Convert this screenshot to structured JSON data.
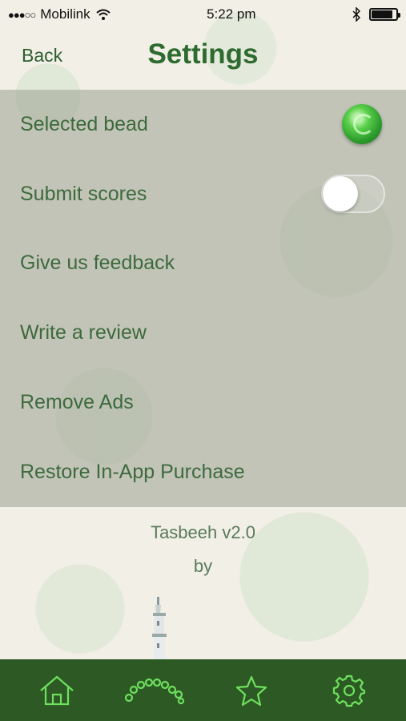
{
  "status_bar": {
    "signal": "●●●○○",
    "carrier": "Mobilink",
    "time": "5:22 pm",
    "bluetooth_icon": "bluetooth-icon",
    "battery_icon": "battery-icon"
  },
  "nav": {
    "back_label": "Back",
    "title": "Settings"
  },
  "settings": [
    {
      "label": "Selected bead",
      "control": "bead"
    },
    {
      "label": "Submit scores",
      "control": "toggle",
      "value": false
    },
    {
      "label": "Give us feedback"
    },
    {
      "label": "Write a review"
    },
    {
      "label": "Remove Ads"
    },
    {
      "label": "Restore In-App Purchase"
    }
  ],
  "footer": {
    "app_version": "Tasbeeh v2.0",
    "by": "by"
  },
  "tab_bar": {
    "tabs": [
      {
        "icon": "home-icon"
      },
      {
        "icon": "beads-icon"
      },
      {
        "icon": "star-icon"
      },
      {
        "icon": "gear-icon"
      }
    ]
  },
  "colors": {
    "accent": "#2e6b2e",
    "tab_bar": "#2d5a24",
    "tab_icon": "#6ee05e"
  }
}
